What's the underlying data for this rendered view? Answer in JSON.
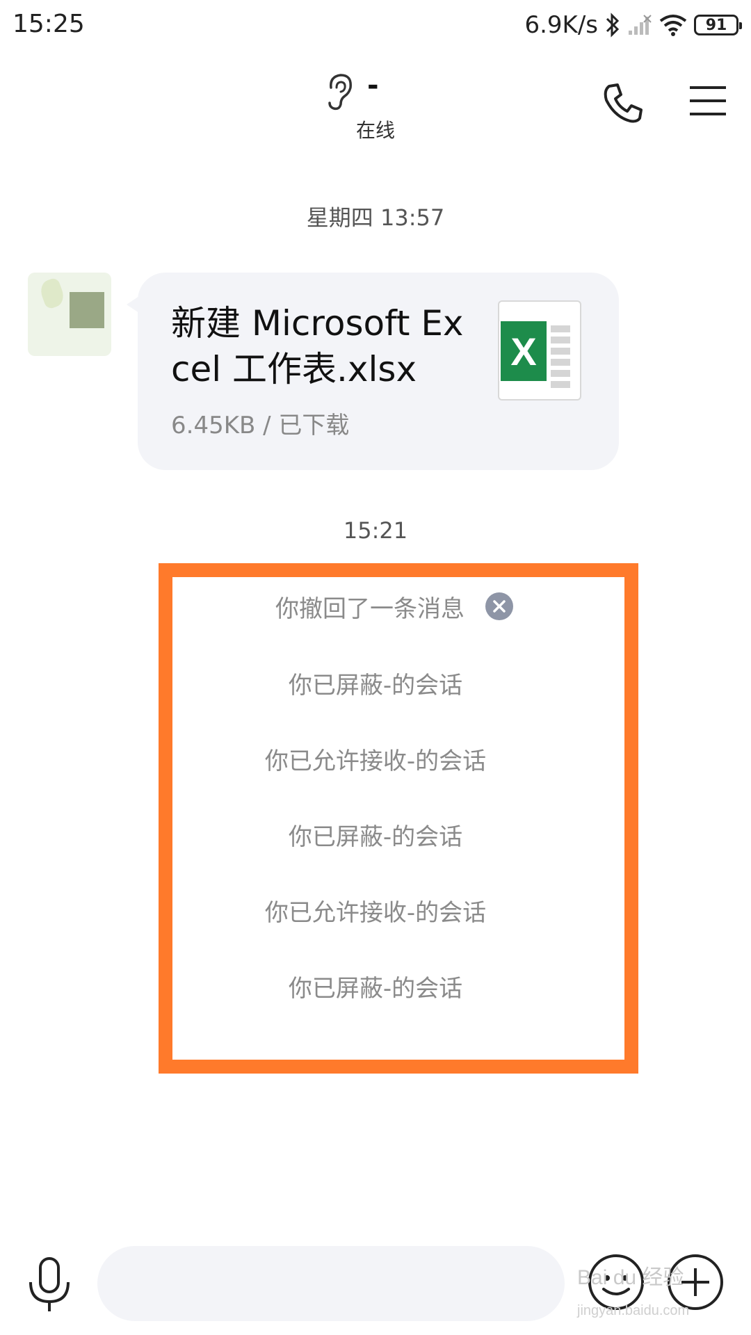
{
  "status_bar": {
    "time": "15:25",
    "net_speed": "6.9K/s",
    "battery": "91",
    "icons": [
      "bluetooth-icon",
      "cellular-no-signal-icon",
      "wifi-icon",
      "battery-icon"
    ]
  },
  "header": {
    "contact_name": "-",
    "contact_status": "在线",
    "icons": [
      "ear-icon",
      "phone-icon",
      "menu-icon"
    ]
  },
  "messages": {
    "timestamp_1": "星期四 13:57",
    "file": {
      "name": "新建 Microsoft Excel 工作表.xlsx",
      "meta": "6.45KB / 已下载",
      "icon_letter": "X"
    },
    "timestamp_2": "15:21",
    "recalled": "你撤回了一条消息",
    "system": [
      "你已屏蔽-的会话",
      "你已允许接收-的会话",
      "你已屏蔽-的会话",
      "你已允许接收-的会话",
      "你已屏蔽-的会话"
    ]
  },
  "input_bar": {
    "placeholder": "",
    "icons": [
      "mic-icon",
      "emoji-icon",
      "plus-icon"
    ]
  },
  "colors": {
    "highlight": "#ff7a2b",
    "bubble": "#f3f4f8",
    "excel_green": "#1d8c4b"
  },
  "watermark": {
    "text": "Bai du 经验",
    "sub": "jingyan.baidu.com"
  }
}
